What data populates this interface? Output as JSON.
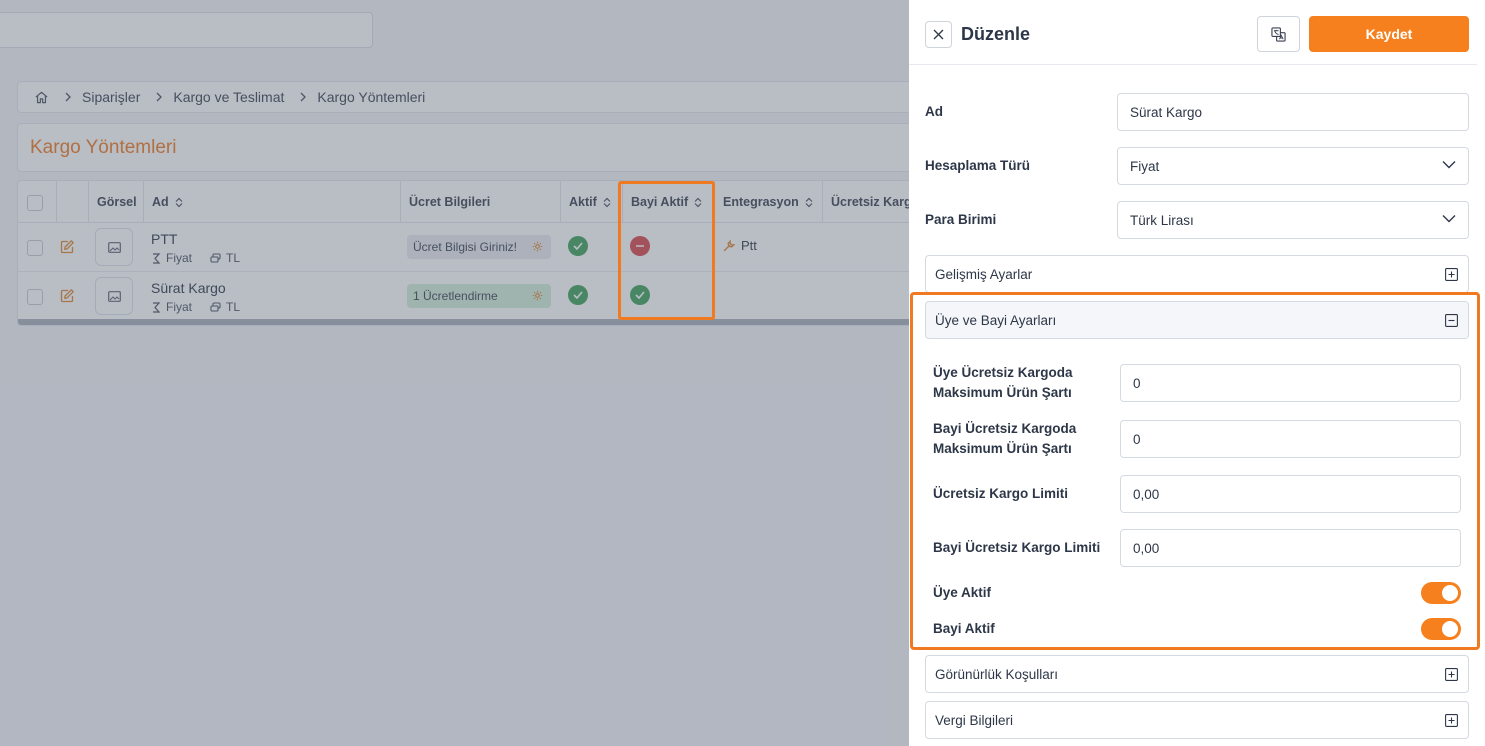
{
  "breadcrumb": {
    "items": [
      "Siparişler",
      "Kargo ve Teslimat",
      "Kargo Yöntemleri"
    ]
  },
  "page": {
    "title": "Kargo Yöntemleri"
  },
  "table": {
    "columns": {
      "gorsel": "Görsel",
      "ad": "Ad",
      "ucret": "Ücret Bilgileri",
      "aktif": "Aktif",
      "bayi_aktif": "Bayi Aktif",
      "entegrasyon": "Entegrasyon",
      "ucretsiz_kargo": "Ücretsiz Kargo"
    },
    "rows": [
      {
        "name": "PTT",
        "calc": "Fiyat",
        "currency": "TL",
        "price_info": "Ücret Bilgisi Giriniz!",
        "aktif": "active",
        "bayi_aktif": "inactive",
        "integration": "Ptt"
      },
      {
        "name": "Sürat Kargo",
        "calc": "Fiyat",
        "currency": "TL",
        "price_info": "1 Ücretlendirme",
        "aktif": "active",
        "bayi_aktif": "active",
        "integration": ""
      }
    ]
  },
  "panel": {
    "title": "Düzenle",
    "save_label": "Kaydet",
    "fields": {
      "ad_label": "Ad",
      "ad_value": "Sürat Kargo",
      "hesaplama_label": "Hesaplama Türü",
      "hesaplama_value": "Fiyat",
      "para_label": "Para Birimi",
      "para_value": "Türk Lirası"
    },
    "sections": {
      "gelismis": "Gelişmiş Ayarlar",
      "uye_bayi": "Üye ve Bayi Ayarları",
      "gorunurluk": "Görünürlük Koşulları",
      "vergi": "Vergi Bilgileri"
    },
    "uye_bayi": {
      "uye_max_label_1": "Üye Ücretsiz Kargoda",
      "uye_max_label_2": "Maksimum Ürün Şartı",
      "uye_max_value": "0",
      "bayi_max_label_1": "Bayi Ücretsiz Kargoda",
      "bayi_max_label_2": "Maksimum Ürün Şartı",
      "bayi_max_value": "0",
      "limit_label": "Ücretsiz Kargo Limiti",
      "limit_value": "0,00",
      "bayi_limit_label": "Bayi Ücretsiz Kargo Limiti",
      "bayi_limit_value": "0,00",
      "uye_aktif_label": "Üye Aktif",
      "uye_aktif": true,
      "bayi_aktif_label": "Bayi Aktif",
      "bayi_aktif": true
    }
  },
  "colors": {
    "accent": "#f7801e",
    "success": "#3fa35b",
    "danger": "#d9454a",
    "highlight": "#f07a22"
  }
}
